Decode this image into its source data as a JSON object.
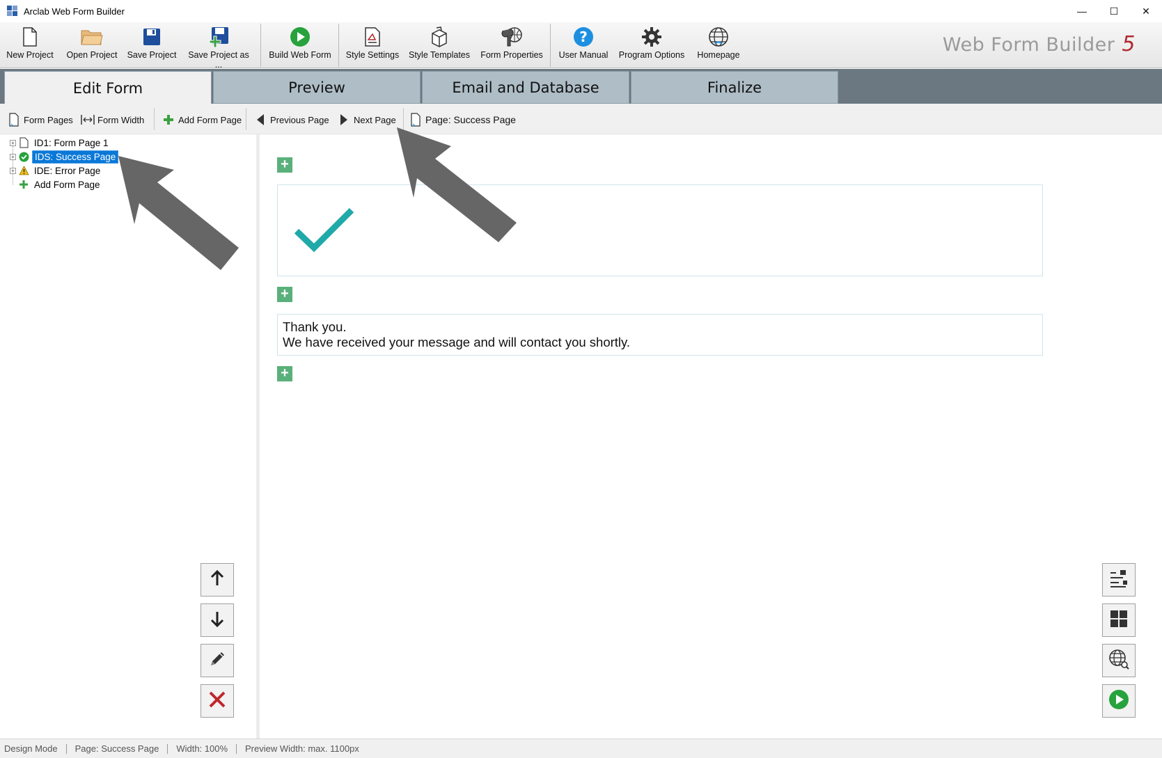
{
  "window": {
    "title": "Arclab Web Form Builder",
    "controls": {
      "minimize": "—",
      "maximize": "☐",
      "close": "✕"
    }
  },
  "ribbon": {
    "buttons": [
      {
        "label": "New Project",
        "icon": "new-file-icon"
      },
      {
        "label": "Open Project",
        "icon": "open-folder-icon"
      },
      {
        "label": "Save Project",
        "icon": "save-disk-icon"
      },
      {
        "label": "Save Project as ...",
        "icon": "save-as-disk-icon"
      },
      {
        "label": "Build Web Form",
        "icon": "play-build-icon"
      },
      {
        "label": "Style Settings",
        "icon": "style-settings-icon"
      },
      {
        "label": "Style Templates",
        "icon": "style-templates-icon"
      },
      {
        "label": "Form Properties",
        "icon": "form-properties-icon"
      },
      {
        "label": "User Manual",
        "icon": "help-icon"
      },
      {
        "label": "Program Options",
        "icon": "gear-icon"
      },
      {
        "label": "Homepage",
        "icon": "globe-icon"
      }
    ],
    "brand": {
      "name": "Web Form Builder",
      "version": "5"
    }
  },
  "tabs": [
    {
      "label": "Edit Form",
      "active": true
    },
    {
      "label": "Preview",
      "active": false
    },
    {
      "label": "Email and Database",
      "active": false
    },
    {
      "label": "Finalize",
      "active": false
    }
  ],
  "subtoolbar": {
    "form_pages": "Form Pages",
    "form_width": "Form Width",
    "add_form_page": "Add Form Page",
    "previous_page": "Previous Page",
    "next_page": "Next Page",
    "current_page": "Page: Success Page"
  },
  "tree": {
    "items": [
      {
        "label": "ID1: Form Page 1",
        "icon": "page-icon",
        "selected": false
      },
      {
        "label": "IDS: Success Page",
        "icon": "success-check-icon",
        "selected": true
      },
      {
        "label": "IDE: Error Page",
        "icon": "warning-icon",
        "selected": false
      },
      {
        "label": "Add Form Page",
        "icon": "add-icon",
        "selected": false
      }
    ]
  },
  "canvas": {
    "message_line1": "Thank you.",
    "message_line2": "We have received your message and will contact you shortly.",
    "add_symbol": "+"
  },
  "statusbar": {
    "mode": "Design Mode",
    "page": "Page: Success Page",
    "width": "Width: 100%",
    "preview_width": "Preview Width: max. 1100px"
  },
  "colors": {
    "tabbar": "#6b7882",
    "tab_inactive": "#aebdc6",
    "selection": "#0a78d7",
    "add_green": "#5ab07a",
    "check_teal": "#1fa9a8",
    "arrow_gray": "#666666",
    "brand_red": "#b0292f"
  }
}
